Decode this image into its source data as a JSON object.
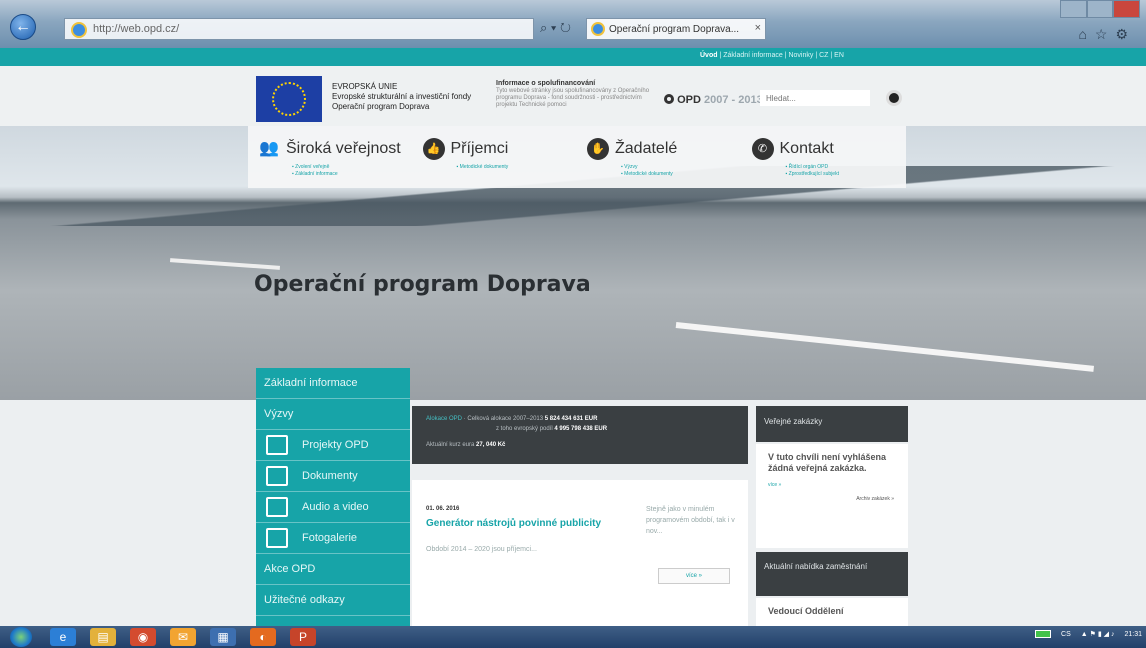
{
  "browser": {
    "address": "http://web.opd.cz/",
    "tab_title": "Operační program Doprava...",
    "tab_close": "×",
    "search_refresh": "⌕ ▾ ↻"
  },
  "topstrip": {
    "links": [
      "Úvod",
      "Základní informace",
      "Novinky",
      "CZ",
      "EN"
    ]
  },
  "header": {
    "eu_line1": "EVROPSKÁ UNIE",
    "eu_line2": "Evropské strukturální a investiční fondy",
    "eu_line3": "Operační program Doprava",
    "info_title": "Informace o spolufinancování",
    "info_text": "Tyto webové stránky jsou spolufinancovány z Operačního programu Doprava - fond soudržnosti - prostřednictvím projektu Technické pomoci",
    "opd_label": "OPD",
    "opd_years": "2007 - 2013",
    "search_placeholder": "Hledat..."
  },
  "nav": [
    {
      "title": "Široká veřejnost",
      "icon": "people-icon",
      "links": [
        "Zvolení veřejně",
        "Základní informace"
      ]
    },
    {
      "title": "Příjemci",
      "icon": "thumb-icon",
      "links": [
        "Metodické dokumenty"
      ]
    },
    {
      "title": "Žadatelé",
      "icon": "hand-icon",
      "links": [
        "Výzvy",
        "Metodické dokumenty"
      ]
    },
    {
      "title": "Kontakt",
      "icon": "phone-icon",
      "links": [
        "Řídící orgán OPD",
        "Zprostředkující subjekt"
      ]
    }
  ],
  "hero": {
    "title": "Operační program Doprava"
  },
  "sidebar": [
    {
      "label": "Základní informace",
      "sub": false
    },
    {
      "label": "Výzvy",
      "sub": false
    },
    {
      "label": "Projekty OPD",
      "sub": true,
      "icon": "edit-icon"
    },
    {
      "label": "Dokumenty",
      "sub": true,
      "icon": "document-icon"
    },
    {
      "label": "Audio a video",
      "sub": true,
      "icon": "video-icon"
    },
    {
      "label": "Fotogalerie",
      "sub": true,
      "icon": "photo-icon"
    },
    {
      "label": "Akce OPD",
      "sub": false
    },
    {
      "label": "Užitečné odkazy",
      "sub": false
    }
  ],
  "stats": {
    "line1_prefix": "Alokace OPD",
    "line1_label": "Celková alokace 2007–2013",
    "line1_value": "5 824 434 631 EUR",
    "line2_label": "z toho evropský podíl",
    "line2_value": "4 995 798 438 EUR",
    "line3_label": "Aktuální kurz eura",
    "line3_value": "27, 040 Kč"
  },
  "news": {
    "date": "01. 06. 2016",
    "headline": "Generátor nástrojů povinné publicity",
    "excerpt": "Období 2014 – 2020 jsou příjemci...",
    "side_text": "Stejně jako v minulém programovém období, tak i v nov...",
    "more": "více »"
  },
  "right": {
    "tenders_title": "Veřejné zakázky",
    "tenders_text": "V tuto chvíli není vyhlášena žádná veřejná zakázka.",
    "tenders_more": "více »",
    "tenders_archive": "Archiv zakázek »",
    "jobs_title": "Aktuální nabídka zaměstnání",
    "jobs_text": "Vedoucí Oddělení"
  },
  "taskbar": {
    "tray_lang": "CS",
    "tray_time": "21:31"
  }
}
